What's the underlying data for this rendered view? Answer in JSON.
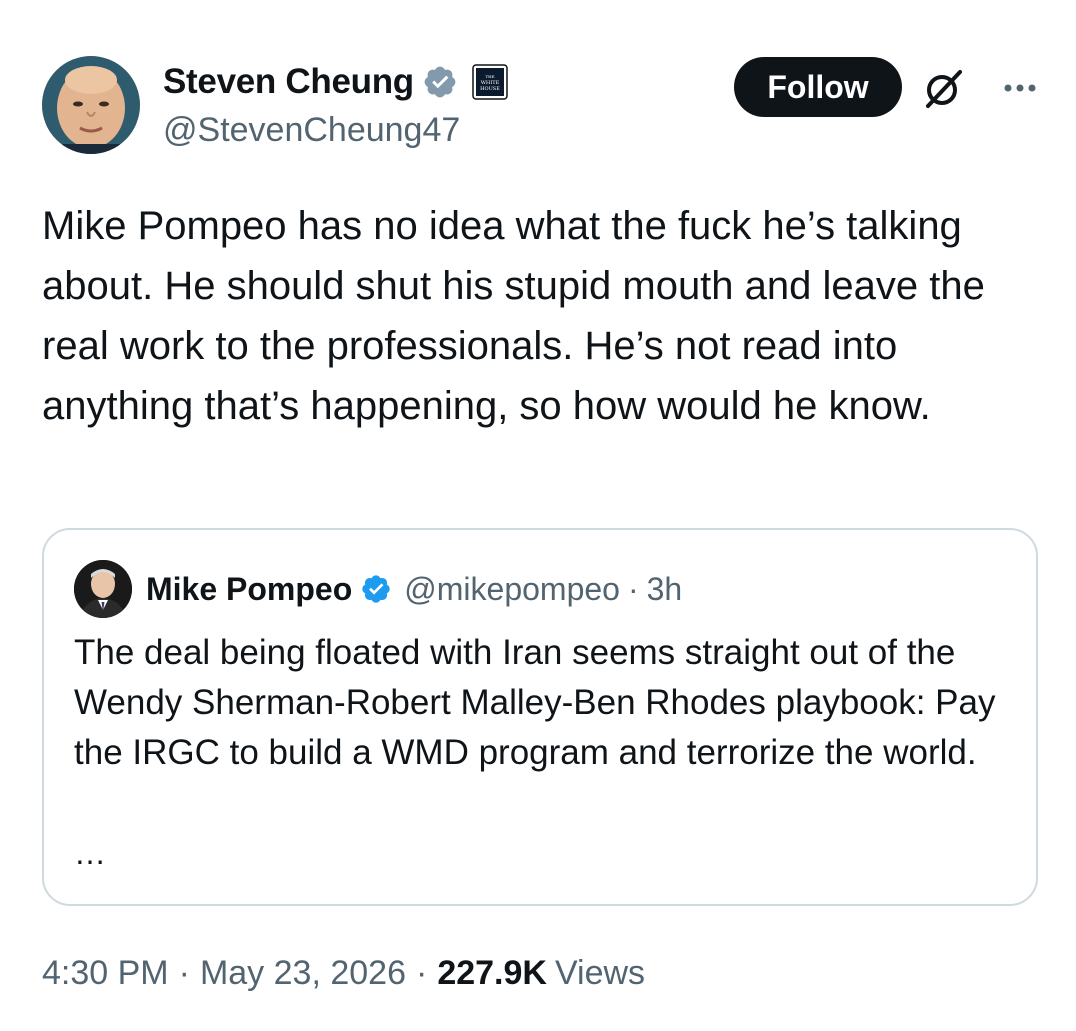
{
  "author": {
    "display_name": "Steven Cheung",
    "handle": "@StevenCheung47",
    "verified_icon": "verified-badge-gray-icon",
    "affiliation_badge_text": "THE WHITE HOUSE"
  },
  "actions": {
    "follow_label": "Follow",
    "grok_icon": "grok-icon",
    "more_icon": "more-icon"
  },
  "tweet": {
    "text": "Mike Pompeo has no idea what the fuck he’s talking about. He should shut his stupid mouth and leave the real work to the professionals. He’s not read into anything that’s happening, so how would he know."
  },
  "quote": {
    "display_name": "Mike Pompeo",
    "handle": "@mikepompeo",
    "separator": "·",
    "time": "3h",
    "text": "The deal being floated with Iran seems straight out of the Wendy Sherman-Robert Malley-Ben Rhodes playbook: Pay the IRGC to build a WMD program and terrorize the world.",
    "ellipsis": "…"
  },
  "meta": {
    "time": "4:30 PM",
    "sep1": "·",
    "date": "May 23, 2026",
    "sep2": "·",
    "views_count": "227.9K",
    "views_label": "Views"
  },
  "colors": {
    "text_primary": "#0f1419",
    "text_secondary": "#536471",
    "border": "#cfd9de",
    "verified_gray": "#829aab",
    "verified_blue": "#1d9bf0"
  }
}
